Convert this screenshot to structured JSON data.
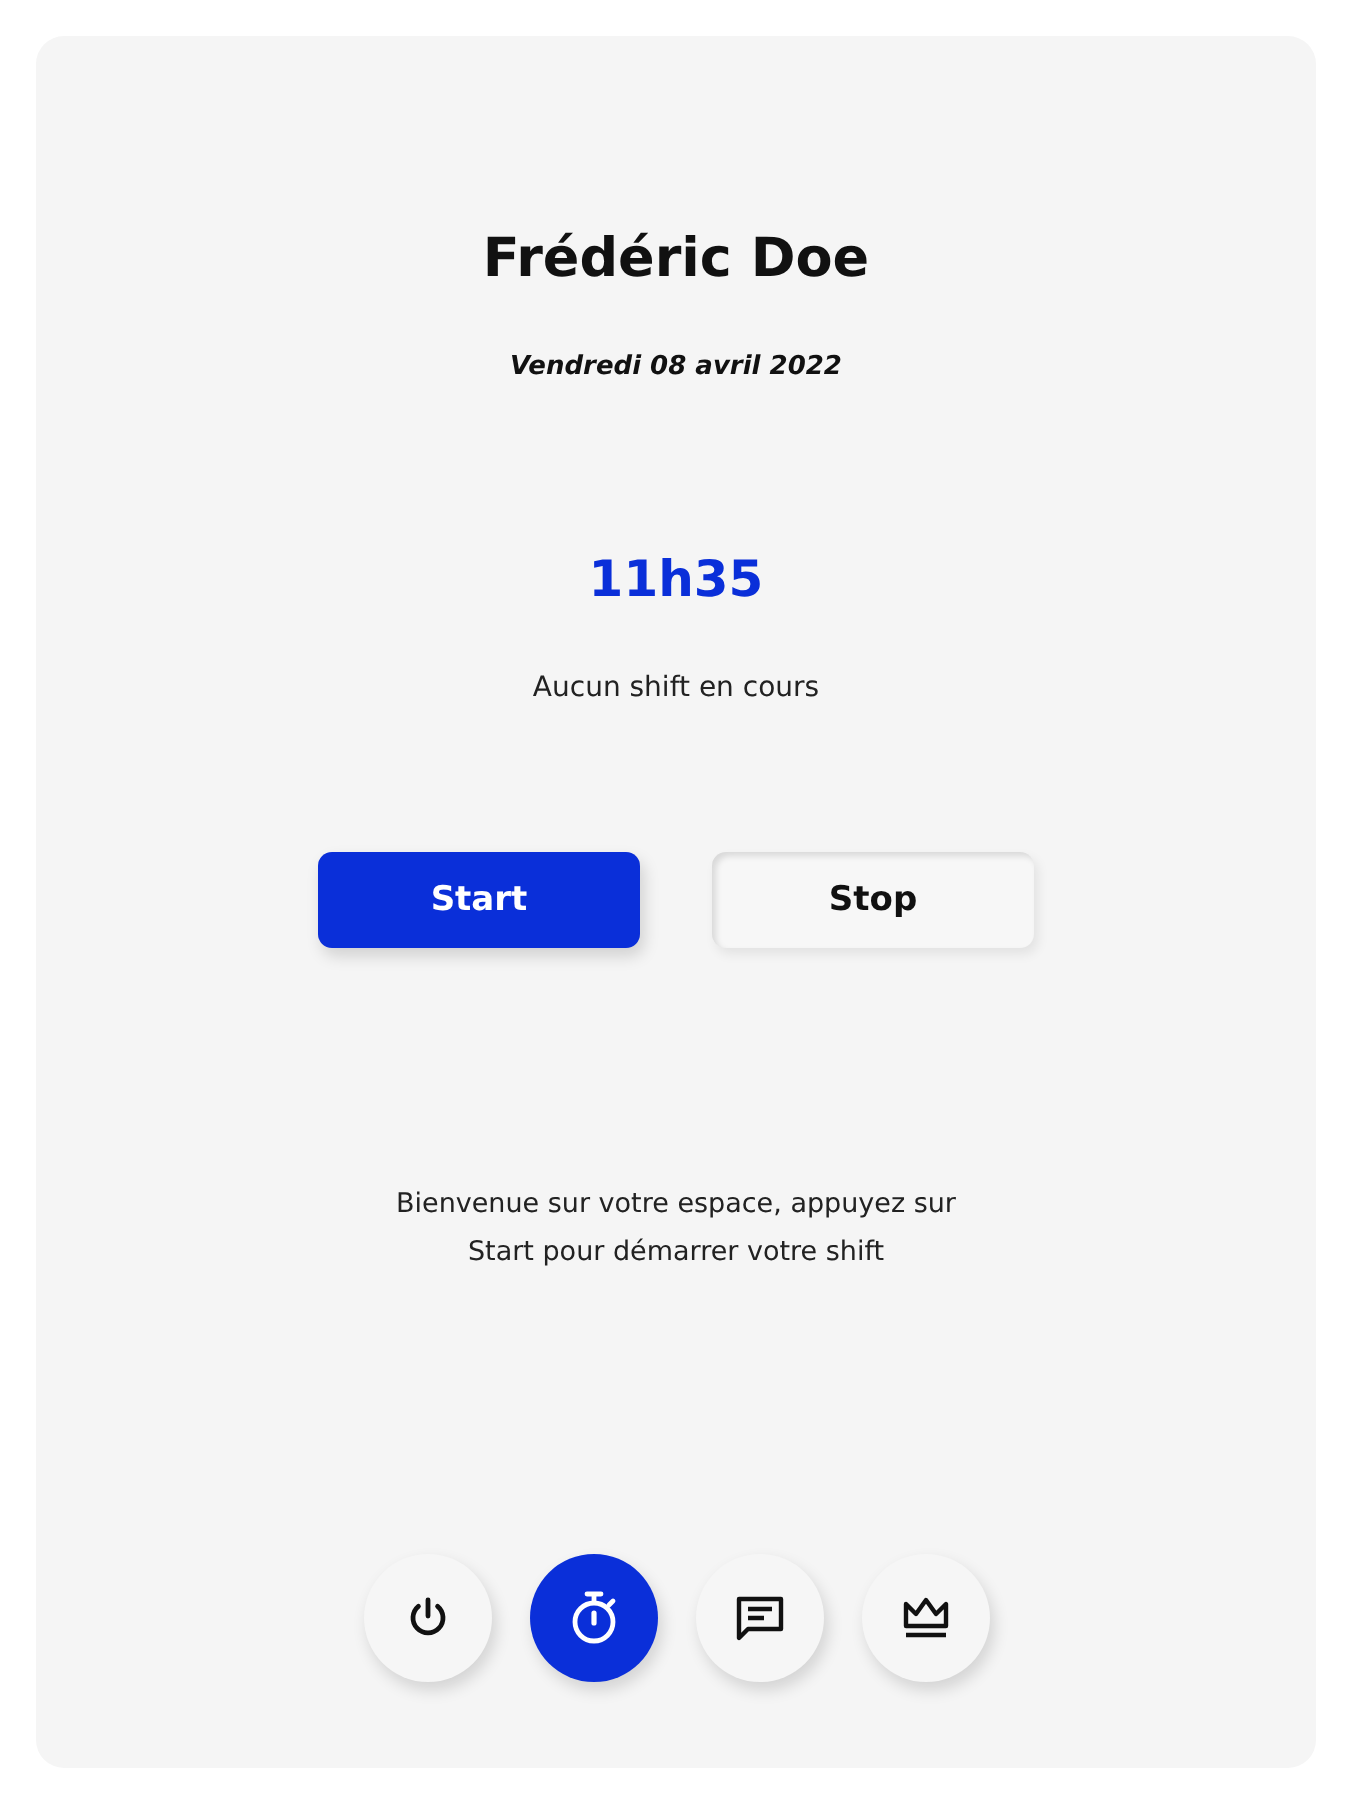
{
  "user": {
    "name": "Frédéric Doe",
    "date": "Vendredi 08 avril 2022"
  },
  "clock": {
    "time": "11h35",
    "status": "Aucun shift en cours"
  },
  "actions": [
    {
      "label": "Start",
      "kind": "primary"
    },
    {
      "label": "Stop",
      "kind": "secondary"
    }
  ],
  "message": "Bienvenue sur votre espace, appuyez sur Start pour démarrer votre shift",
  "nav": [
    {
      "kind": "power",
      "selected": false
    },
    {
      "kind": "stopwatch",
      "selected": true
    },
    {
      "kind": "chat",
      "selected": false
    },
    {
      "kind": "crown",
      "selected": false
    }
  ]
}
